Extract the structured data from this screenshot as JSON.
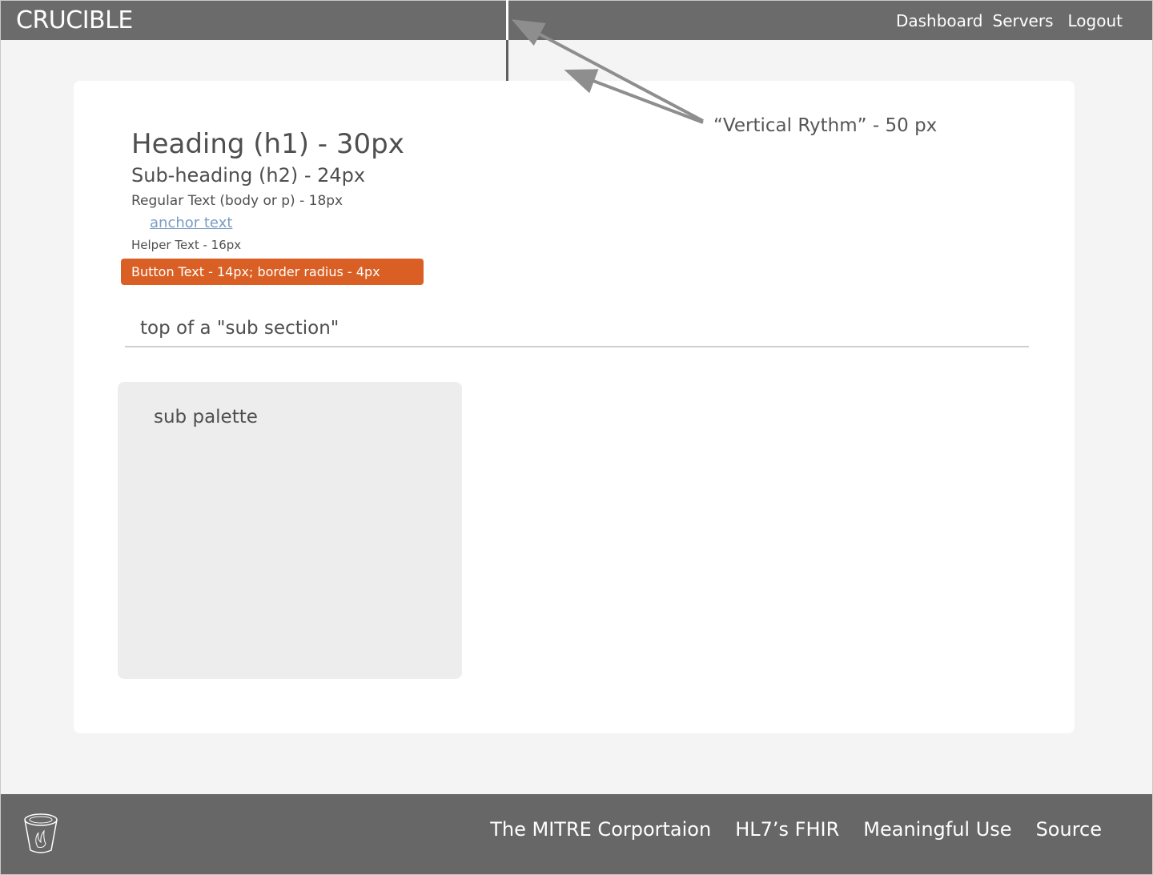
{
  "header": {
    "brand": "CRUCIBLE",
    "nav": [
      "Dashboard",
      "Servers",
      "Logout"
    ]
  },
  "annotation": {
    "label": "“Vertical Rythm” - 50 px"
  },
  "content": {
    "h1": "Heading (h1) - 30px",
    "h2": "Sub-heading (h2) - 24px",
    "body_text": "Regular Text (body or p) - 18px",
    "anchor_text": "anchor text",
    "helper_text": "Helper Text - 16px",
    "button_label": "Button Text - 14px; border radius - 4px"
  },
  "subsection": {
    "title": "top of a \"sub section\""
  },
  "sub_palette": {
    "title": "sub palette"
  },
  "footer": {
    "links": [
      "The MITRE Corportaion",
      "HL7’s FHIR",
      "Meaningful Use",
      "Source"
    ]
  },
  "colors": {
    "header_bg": "#6b6b6b",
    "footer_bg": "#676767",
    "page_bg": "#f4f4f4",
    "card_bg": "#ffffff",
    "button_bg": "#d95f24",
    "anchor": "#7a9cc4",
    "sub_palette_bg": "#ededed"
  },
  "icons": {
    "footer_logo": "crucible-cup-icon"
  }
}
